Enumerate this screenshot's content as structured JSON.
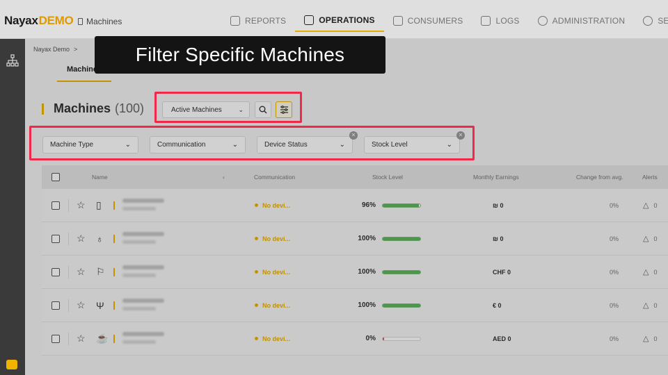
{
  "app": {
    "brand": "Nayax",
    "demo": "DEMO",
    "title": "Machines"
  },
  "nav": [
    {
      "label": "REPORTS",
      "icon": "report-icon"
    },
    {
      "label": "OPERATIONS",
      "icon": "operations-icon",
      "active": true
    },
    {
      "label": "CONSUMERS",
      "icon": "consumers-icon"
    },
    {
      "label": "LOGS",
      "icon": "logs-icon"
    },
    {
      "label": "ADMINISTRATION",
      "icon": "administration-icon"
    },
    {
      "label": "SETTINGS",
      "icon": "gear-icon"
    }
  ],
  "breadcrumb": [
    "Nayax Demo",
    ">"
  ],
  "subtabs": [
    "Machines"
  ],
  "heading": {
    "title": "Machines",
    "count": "(100)"
  },
  "toolbar": {
    "active_select": "Active Machines"
  },
  "filters": [
    "Machine Type",
    "Communication",
    "Device Status",
    "Stock Level"
  ],
  "columns": {
    "name": "Name",
    "communication": "Communication",
    "stock": "Stock Level",
    "earnings": "Monthly Earnings",
    "change": "Change from avg.",
    "alerts": "Alerts"
  },
  "rows": [
    {
      "icon": "vending-machine-icon",
      "glyph": "▯",
      "comm": "No devi...",
      "stock_label": "96%",
      "stock_pct": 96,
      "earnings": "₪ 0",
      "change": "0%",
      "alerts": "0"
    },
    {
      "icon": "balloon-icon",
      "glyph": "♁",
      "comm": "No devi...",
      "stock_label": "100%",
      "stock_pct": 100,
      "earnings": "₪ 0",
      "change": "0%",
      "alerts": "0"
    },
    {
      "icon": "kiddie-ride-icon",
      "glyph": "⚐",
      "comm": "No devi...",
      "stock_label": "100%",
      "stock_pct": 100,
      "earnings": "CHF 0",
      "change": "0%",
      "alerts": "0"
    },
    {
      "icon": "fork-knife-icon",
      "glyph": "Ψ",
      "comm": "No devi...",
      "stock_label": "100%",
      "stock_pct": 100,
      "earnings": "€ 0",
      "change": "0%",
      "alerts": "0"
    },
    {
      "icon": "coffee-machine-icon",
      "glyph": "☕",
      "comm": "No devi...",
      "stock_label": "0%",
      "stock_pct": 4,
      "earnings": "AED 0",
      "change": "0%",
      "alerts": "0"
    }
  ],
  "caption": "Filter Specific Machines",
  "colors": {
    "accent": "#f0b400",
    "highlight": "#f0284a",
    "caption_bg": "#141414"
  }
}
